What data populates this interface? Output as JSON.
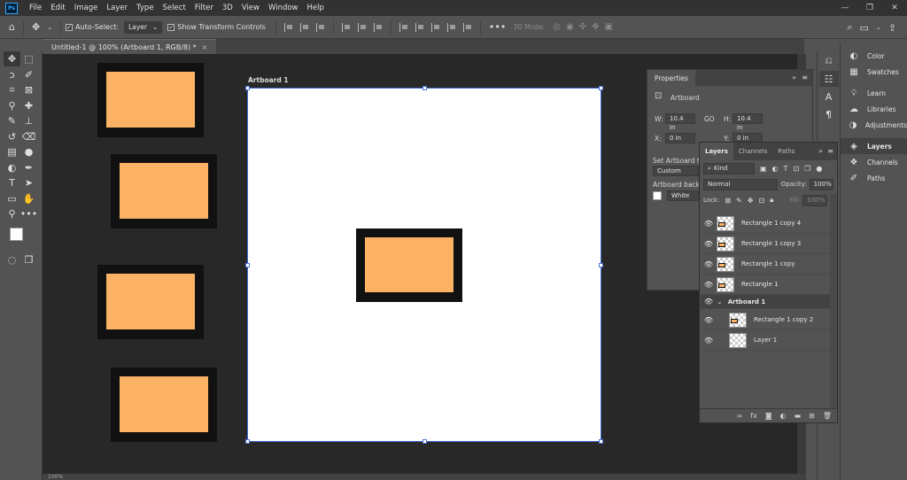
{
  "app": {
    "logo": "Ps"
  },
  "menu": [
    "File",
    "Edit",
    "Image",
    "Layer",
    "Type",
    "Select",
    "Filter",
    "3D",
    "View",
    "Window",
    "Help"
  ],
  "options": {
    "auto_select_label": "Auto-Select:",
    "auto_select_value": "Layer",
    "show_transform_label": "Show Transform Controls",
    "more": "•••",
    "threed_mode_label": "3D Mode:"
  },
  "document": {
    "tab_title": "Untitled-1 @ 100% (Artboard 1, RGB/8) *",
    "close": "×"
  },
  "canvas": {
    "artboard_label": "Artboard 1"
  },
  "properties": {
    "title": "Properties",
    "section": "Artboard",
    "w_label": "W:",
    "w_value": "10.4 in",
    "link_label": "GO",
    "h_label": "H:",
    "h_value": "10.4 in",
    "x_label": "X:",
    "x_value": "0 in",
    "y_label": "Y:",
    "y_value": "0 in",
    "preset_label": "Set Artboard to P",
    "preset_value": "Custom",
    "bg_label": "Artboard backgrou",
    "bg_value": "White"
  },
  "layers": {
    "tabs": [
      "Layers",
      "Channels",
      "Paths"
    ],
    "kind_label": "Kind",
    "blend_mode": "Normal",
    "opacity_label": "Opacity:",
    "opacity_value": "100%",
    "lock_label": "Lock:",
    "fill_label": "Fill:",
    "fill_value": "100%",
    "items": [
      {
        "name": "Rectangle 1 copy 4"
      },
      {
        "name": "Rectangle 1 copy 3"
      },
      {
        "name": "Rectangle 1 copy"
      },
      {
        "name": "Rectangle 1"
      },
      {
        "name": "Artboard 1"
      },
      {
        "name": "Rectangle 1 copy 2"
      },
      {
        "name": "Layer 1"
      }
    ]
  },
  "dock": [
    "Color",
    "Swatches",
    "Learn",
    "Libraries",
    "Adjustments",
    "Layers",
    "Channels",
    "Paths"
  ],
  "status": {
    "zoom": "100%"
  },
  "colors": {
    "orange": "#fbb264",
    "frame": "#111111",
    "selection": "#3a6bd6"
  }
}
